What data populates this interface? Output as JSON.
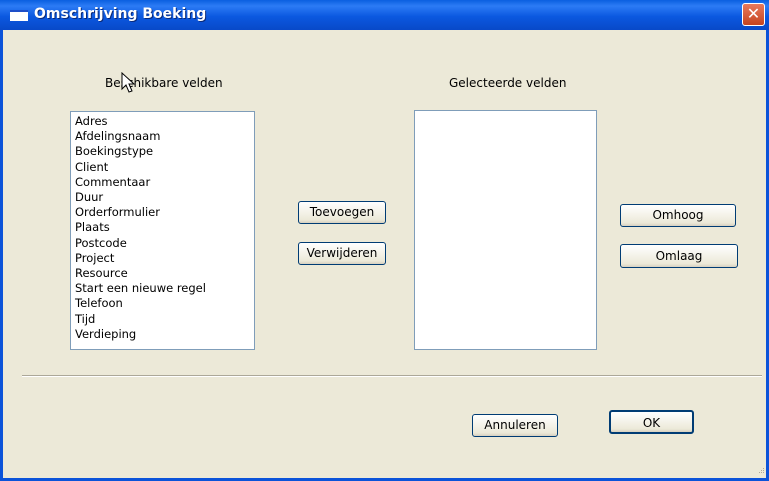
{
  "window": {
    "title": "Omschrijving Boeking"
  },
  "available": {
    "label": "Beschikbare velden",
    "items": [
      "Adres",
      "Afdelingsnaam",
      "Boekingstype",
      "Client",
      "Commentaar",
      "Duur",
      "Orderformulier",
      "Plaats",
      "Postcode",
      "Project",
      "Resource",
      "Start een nieuwe regel",
      "Telefoon",
      "Tijd",
      "Verdieping"
    ]
  },
  "selected": {
    "label": "Gelecteerde velden",
    "items": []
  },
  "buttons": {
    "add": "Toevoegen",
    "remove": "Verwijderen",
    "up": "Omhoog",
    "down": "Omlaag",
    "cancel": "Annuleren",
    "ok": "OK"
  },
  "colors": {
    "titlebar": "#0b58e0",
    "dialog_bg": "#ece9d8",
    "close": "#d8542e"
  }
}
